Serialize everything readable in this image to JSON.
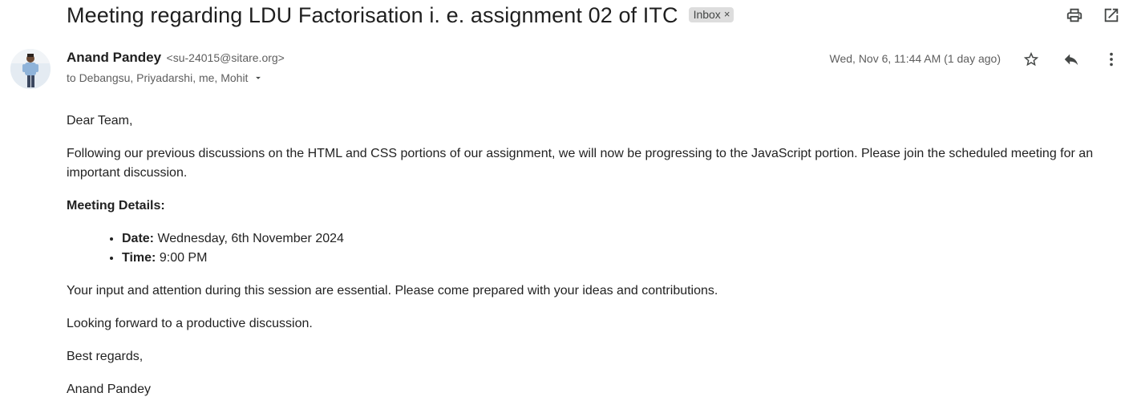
{
  "email": {
    "subject": "Meeting regarding LDU Factorisation i. e. assignment 02 of ITC",
    "label": "Inbox",
    "label_close": "×",
    "sender_name": "Anand Pandey",
    "sender_email": "<su-24015@sitare.org>",
    "recipients": "to Debangsu, Priyadarshi, me, Mohit",
    "timestamp": "Wed, Nov 6, 11:44 AM (1 day ago)"
  },
  "body": {
    "greeting": "Dear Team,",
    "intro": "Following our previous discussions on the HTML and CSS portions of our assignment, we will now be progressing to the JavaScript portion. Please join the scheduled meeting for an important discussion.",
    "details_heading": "Meeting Details:",
    "details": [
      {
        "label": "Date:",
        "value": "Wednesday, 6th November 2024"
      },
      {
        "label": "Time:",
        "value": "9:00 PM"
      }
    ],
    "request": "Your input and attention during this session are essential. Please come prepared with your ideas and contributions.",
    "closing_line": "Looking forward to a productive discussion.",
    "signoff": "Best regards,",
    "signature": "Anand Pandey"
  },
  "icons": {
    "print": "print-icon",
    "open_new_window": "open-in-new-window-icon",
    "star": "star-icon",
    "reply": "reply-icon",
    "more": "more-vert-icon",
    "recipients_toggle": "caret-down-icon"
  },
  "colors": {
    "icon": "#444746",
    "meta_text": "#5e5e5e",
    "chip_bg": "#dddddd"
  }
}
